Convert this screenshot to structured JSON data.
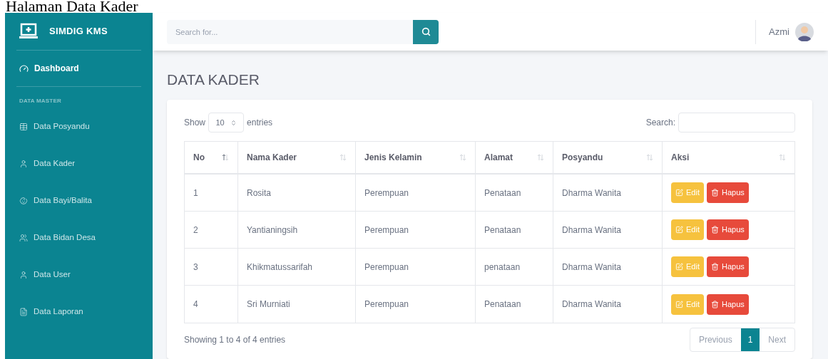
{
  "caption": "Halaman Data Kader",
  "brand": "SIMDIG KMS",
  "sidebar": {
    "items": [
      {
        "label": "Dashboard",
        "selected": true
      }
    ],
    "section": "DATA MASTER",
    "master_items": [
      {
        "label": "Data Posyandu",
        "selected": false
      },
      {
        "label": "Data Kader",
        "selected": false
      },
      {
        "label": "Data Bayi/Balita",
        "selected": false
      },
      {
        "label": "Data Bidan Desa",
        "selected": false
      },
      {
        "label": "Data User",
        "selected": false
      },
      {
        "label": "Data Laporan",
        "selected": false
      }
    ]
  },
  "topbar": {
    "search": {
      "placeholder": "Search for..."
    },
    "user": "Azmi"
  },
  "page_title": "DATA KADER",
  "table_controls": {
    "show_label": "Show",
    "page_size": "10",
    "entries_label": "entries",
    "search_label": "Search:"
  },
  "table": {
    "columns": [
      {
        "label": "No",
        "sorted": true
      },
      {
        "label": "Nama Kader",
        "sorted": false
      },
      {
        "label": "Jenis Kelamin",
        "sorted": false
      },
      {
        "label": "Alamat",
        "sorted": false
      },
      {
        "label": "Posyandu",
        "sorted": false
      },
      {
        "label": "Aksi",
        "sorted": false
      }
    ],
    "rows": [
      {
        "no": "1",
        "nama": "Rosita",
        "jenis_kelamin": "Perempuan",
        "alamat": "Penataan",
        "posyandu": "Dharma Wanita",
        "actions": [
          "Edit",
          "Hapus"
        ]
      },
      {
        "no": "2",
        "nama": "Yantianingsih",
        "jenis_kelamin": "Perempuan",
        "alamat": "Penataan",
        "posyandu": "Dharma Wanita",
        "actions": [
          "Edit",
          "Hapus"
        ]
      },
      {
        "no": "3",
        "nama": "Khikmatussarifah",
        "jenis_kelamin": "Perempuan",
        "alamat": "penataan",
        "posyandu": "Dharma Wanita",
        "actions": [
          "Edit",
          "Hapus"
        ]
      },
      {
        "no": "4",
        "nama": "Sri Murniati",
        "jenis_kelamin": "Perempuan",
        "alamat": "Penataan",
        "posyandu": "Dharma Wanita",
        "actions": [
          "Edit",
          "Hapus"
        ]
      }
    ]
  },
  "footer": {
    "info": "Showing 1 to 4 of 4 entries",
    "previous": "Previous",
    "pages": [
      {
        "label": "1",
        "selected": true
      }
    ],
    "next": "Next"
  }
}
